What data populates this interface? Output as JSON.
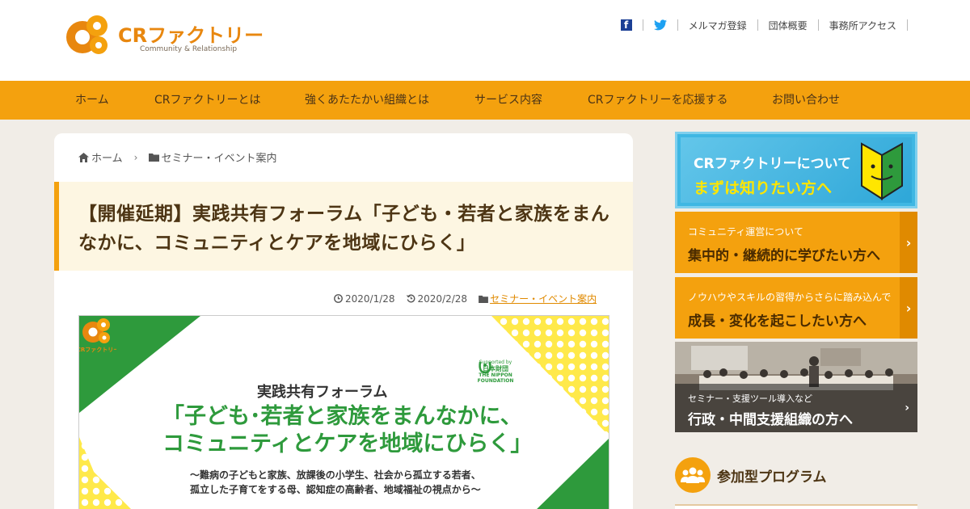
{
  "header": {
    "logo_text": "CRファクトリー",
    "logo_sub": "Community & Relationship",
    "links": [
      "メルマガ登録",
      "団体概要",
      "事務所アクセス"
    ]
  },
  "nav": {
    "items": [
      "ホーム",
      "CRファクトリーとは",
      "強くあたたかい組織とは",
      "サービス内容",
      "CRファクトリーを応援する",
      "お問い合わせ"
    ]
  },
  "breadcrumb": {
    "home": "ホーム",
    "category": "セミナー・イベント案内"
  },
  "article": {
    "title": "【開催延期】実践共有フォーラム「子ども・若者と家族をまんなかに、コミュニティとケアを地域にひらく」",
    "published": "2020/1/28",
    "updated": "2020/2/28",
    "category": "セミナー・イベント案内"
  },
  "hero": {
    "subtitle": "実践共有フォーラム",
    "headline_1": "「子ども･若者と家族をまんなかに、",
    "headline_2": "コミュニティとケアを地域にひらく」",
    "small_1": "〜難病の子どもと家族、放課後の小学生、社会から孤立する若者、",
    "small_2": "孤立した子育てをする母、認知症の高齢者、地域福祉の視点から〜",
    "logo_label": "CRファクトリー",
    "nf_supported": "Supported by",
    "nf_name_jp": "日本財団",
    "nf_name_1": "THE NIPPON",
    "nf_name_2": "FOUNDATION"
  },
  "sidebar": {
    "banner1": {
      "line1": "CRファクトリーについて",
      "line2": "まずは知りたい方へ"
    },
    "banner2": {
      "line1": "コミュニティ運営について",
      "line2": "集中的・継続的に学びたい方へ"
    },
    "banner3": {
      "line1": "ノウハウやスキルの習得からさらに踏み込んで",
      "line2": "成長・変化を起こしたい方へ"
    },
    "banner4": {
      "line1": "セミナー・支援ツール導入など",
      "line2": "行政・中間支援組織の方へ"
    },
    "program_title": "参加型プログラム"
  },
  "colors": {
    "accent_orange": "#f4a10e",
    "brand_green": "#2e9a3c",
    "banner_blue": "#3fb7e3",
    "highlight_yellow": "#ffe600"
  }
}
